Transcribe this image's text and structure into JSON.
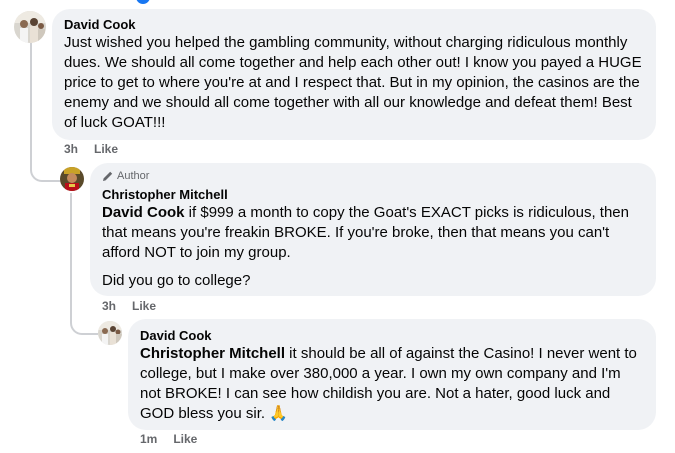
{
  "comments": [
    {
      "author": "David Cook",
      "text": "Just wished you helped the gambling community, without charging ridiculous monthly dues. We should all come together and help each other out! I know you payed a HUGE price to get to where you're at and I respect that. But in my opinion, the casinos are the enemy and we should all come together with all our knowledge and defeat them! Best of luck GOAT!!!",
      "time": "3h",
      "like_label": "Like"
    },
    {
      "badge": "Author",
      "author": "Christopher Mitchell",
      "mention": "David Cook",
      "text": " if $999 a month to copy the Goat's EXACT picks is ridiculous, then that means you're freakin BROKE. If you're broke, then that means you can't afford NOT to join my group.",
      "text2": "Did you go to college?",
      "time": "3h",
      "like_label": "Like"
    },
    {
      "author": "David Cook",
      "mention": "Christopher Mitchell",
      "text": " it should be all of against the Casino! I never went to college, but I make over 380,000 a year. I own my own company and I'm not BROKE! I can see how childish you are. Not a hater, good luck and GOD bless you sir. 🙏",
      "time": "1m",
      "like_label": "Like"
    }
  ],
  "colors": {
    "bubble": "#f0f2f5",
    "meta": "#65676b",
    "thread_line": "#ced0d4"
  }
}
